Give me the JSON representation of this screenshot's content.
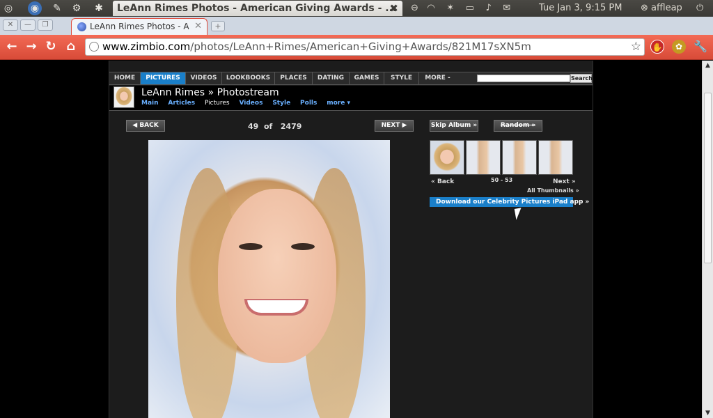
{
  "panel": {
    "window_title": "LeAnn Rimes Photos - American Giving Awards - ...",
    "clock": "Tue Jan  3,  9:15 PM",
    "user": "affleap"
  },
  "tab": {
    "title": "LeAnn Rimes Photos - A"
  },
  "omnibox": {
    "domain": "www.zimbio.com",
    "path": "/photos/LeAnn+Rimes/American+Giving+Awards/821M17sXN5m"
  },
  "nav": {
    "items": [
      "HOME",
      "PICTURES",
      "VIDEOS",
      "LOOKBOOKS",
      "PLACES",
      "DATING",
      "GAMES",
      "STYLE",
      "MORE -"
    ],
    "active": "PICTURES",
    "search_button": "Search"
  },
  "profile": {
    "name": "LeAnn Rimes",
    "separator": "»",
    "section": "Photostream",
    "links": [
      "Main",
      "Articles",
      "Pictures",
      "Videos",
      "Style",
      "Polls",
      "more ▾"
    ],
    "current": "Pictures"
  },
  "pager": {
    "back": "◀ BACK",
    "next": "NEXT ▶",
    "current": "49",
    "of": "of",
    "total": "2479"
  },
  "album": {
    "skip": "Skip Album »",
    "random": "Random »",
    "back": "« Back",
    "range": "50 - 53",
    "next": "Next »",
    "all_thumbnails": "All Thumbnails »",
    "ipad": "Download our Celebrity Pictures iPad app »"
  }
}
